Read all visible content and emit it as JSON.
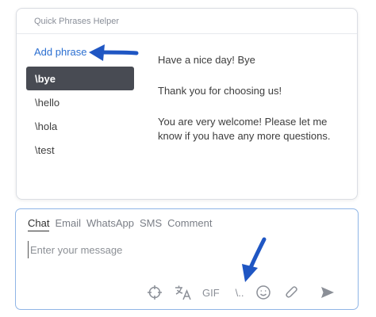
{
  "popup": {
    "title": "Quick Phrases Helper",
    "add_phrase_label": "Add phrase",
    "phrases": [
      {
        "label": "\\bye",
        "active": true
      },
      {
        "label": "\\hello",
        "active": false
      },
      {
        "label": "\\hola",
        "active": false
      },
      {
        "label": "\\test",
        "active": false
      }
    ],
    "preview": [
      "Have a nice day! Bye",
      "Thank you for choosing us!",
      "You are very welcome! Please let me know if you have any more questions."
    ]
  },
  "compose": {
    "tabs": [
      {
        "label": "Chat",
        "active": true
      },
      {
        "label": "Email",
        "active": false
      },
      {
        "label": "WhatsApp",
        "active": false
      },
      {
        "label": "SMS",
        "active": false
      },
      {
        "label": "Comment",
        "active": false
      }
    ],
    "placeholder": "Enter your message",
    "toolbar": {
      "gif_label": "GIF",
      "quick_phrase_label": "\\..",
      "icons": [
        "crosshair-icon",
        "translate-icon",
        "gif-icon",
        "quick-phrase-icon",
        "emoji-icon",
        "attachment-icon",
        "send-icon"
      ]
    }
  },
  "colors": {
    "accent": "#2b6fd1",
    "active_item_bg": "#484b53",
    "compose_border": "#8fb5e6",
    "annotation_arrow": "#1f56c3"
  }
}
